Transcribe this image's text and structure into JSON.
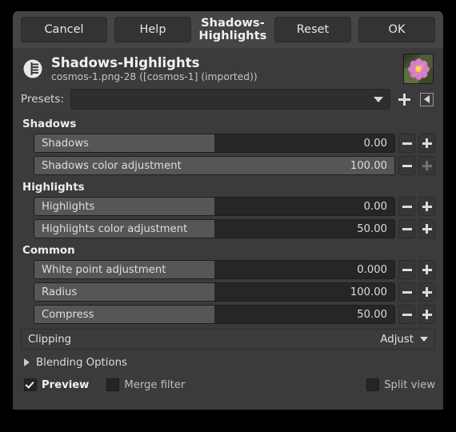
{
  "titlebar": {
    "cancel_label": "Cancel",
    "help_label": "Help",
    "title": "Shadows-Highlights",
    "reset_label": "Reset",
    "ok_label": "OK"
  },
  "op_header": {
    "title": "Shadows-Highlights",
    "subtitle": "cosmos-1.png-28 ([cosmos-1] (imported))",
    "icon": "gegl-icon",
    "thumbnail": "image-thumbnail"
  },
  "presets": {
    "label": "Presets:",
    "value": "",
    "add_icon": "plus-icon",
    "menu_icon": "preset-menu-icon"
  },
  "sections": [
    {
      "title": "Shadows",
      "rows": [
        {
          "label": "Shadows",
          "value": "0.00",
          "fill_pct": 50,
          "plus_enabled": true,
          "minus_enabled": true
        },
        {
          "label": "Shadows color adjustment",
          "value": "100.00",
          "fill_pct": 100,
          "plus_enabled": false,
          "minus_enabled": true
        }
      ]
    },
    {
      "title": "Highlights",
      "rows": [
        {
          "label": "Highlights",
          "value": "0.00",
          "fill_pct": 50,
          "plus_enabled": true,
          "minus_enabled": true
        },
        {
          "label": "Highlights color adjustment",
          "value": "50.00",
          "fill_pct": 50,
          "plus_enabled": true,
          "minus_enabled": true
        }
      ]
    },
    {
      "title": "Common",
      "rows": [
        {
          "label": "White point adjustment",
          "value": "0.000",
          "fill_pct": 50,
          "plus_enabled": true,
          "minus_enabled": true
        },
        {
          "label": "Radius",
          "value": "100.00",
          "fill_pct": 50,
          "plus_enabled": true,
          "minus_enabled": true
        },
        {
          "label": "Compress",
          "value": "50.00",
          "fill_pct": 50,
          "plus_enabled": true,
          "minus_enabled": true
        }
      ]
    }
  ],
  "clipping": {
    "label": "Clipping",
    "value": "Adjust"
  },
  "blending": {
    "label": "Blending Options",
    "expanded": false
  },
  "footer": {
    "preview_label": "Preview",
    "preview_checked": true,
    "merge_label": "Merge filter",
    "merge_checked": false,
    "split_label": "Split view",
    "split_checked": false
  },
  "colors": {
    "window_bg": "#454545",
    "body_bg": "#3b3b3b",
    "slider_trough": "#262626",
    "slider_fill": "#565656",
    "text": "#e6e6e6"
  }
}
